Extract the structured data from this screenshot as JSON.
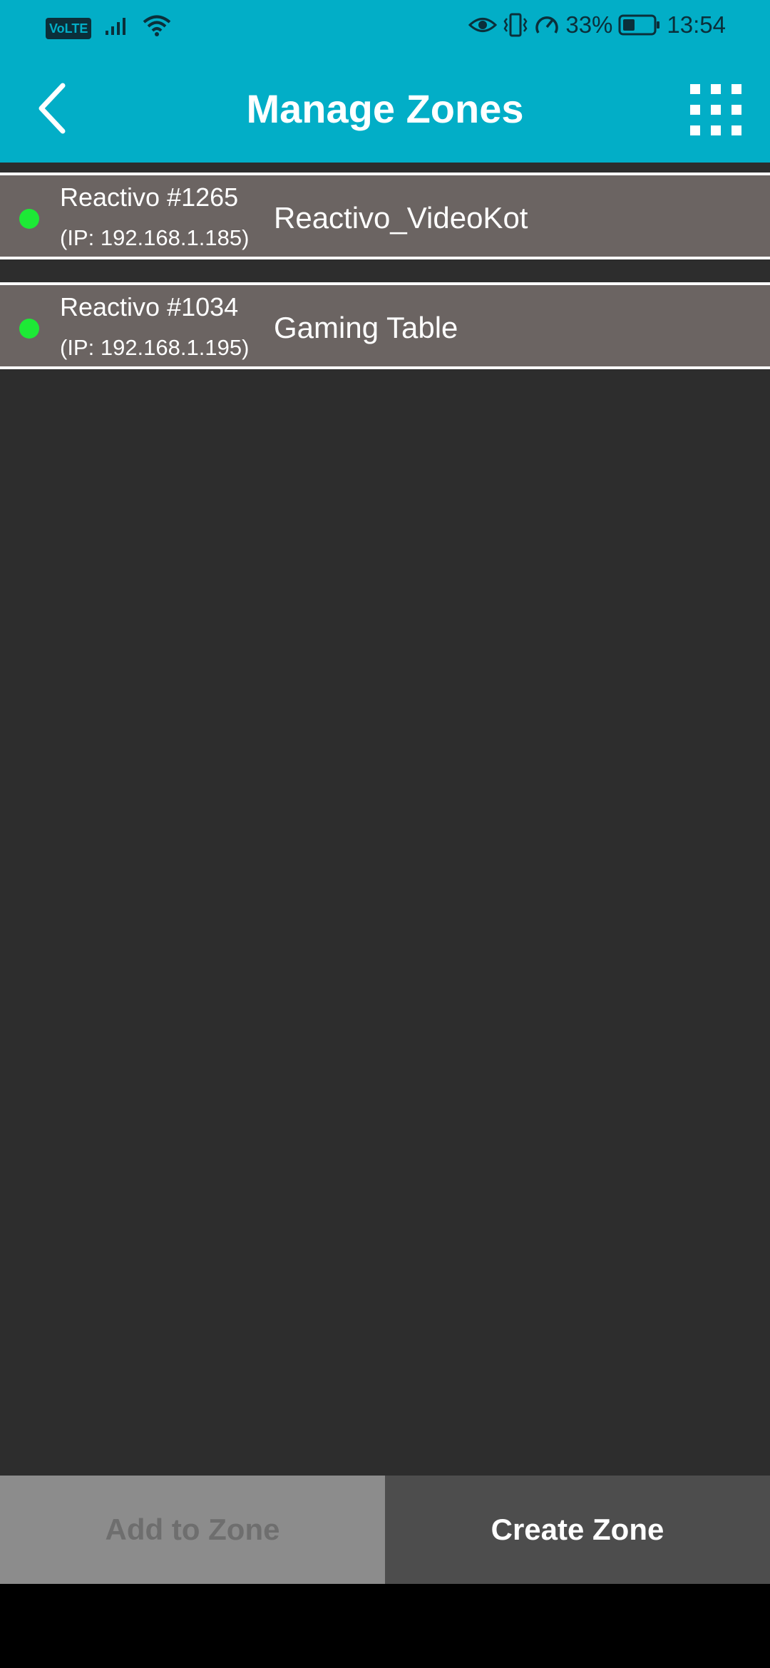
{
  "status_bar": {
    "volte": "VoLTE",
    "battery_percent": "33%",
    "time": "13:54",
    "icons": [
      "signal-icon",
      "wifi-icon",
      "eye-icon",
      "vibrate-icon",
      "speedometer-icon",
      "battery-icon"
    ]
  },
  "header": {
    "title": "Manage Zones",
    "back_icon": "chevron-left-icon",
    "menu_icon": "grid-icon"
  },
  "devices": [
    {
      "name": "Reactivo #1265",
      "ip": "(IP: 192.168.1.185)",
      "zone": "Reactivo_VideoKot",
      "status_color": "#1de936"
    },
    {
      "name": "Reactivo #1034",
      "ip": "(IP: 192.168.1.195)",
      "zone": "Gaming Table",
      "status_color": "#1de936"
    }
  ],
  "footer": {
    "add_label": "Add to Zone",
    "create_label": "Create Zone"
  },
  "colors": {
    "accent": "#02aec7",
    "row_bg": "#6b6462",
    "content_bg": "#2d2d2d"
  }
}
